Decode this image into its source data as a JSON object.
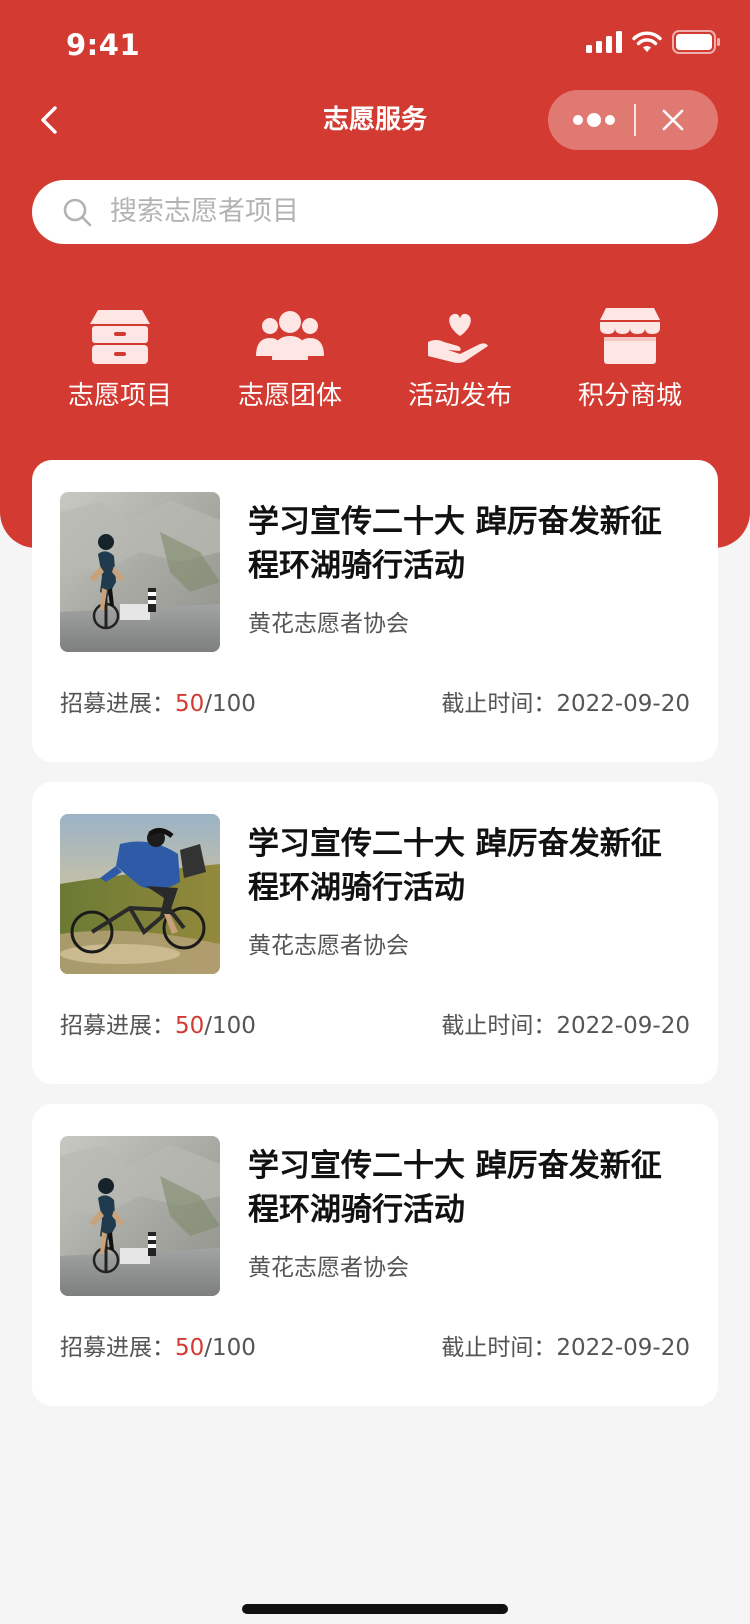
{
  "status_bar": {
    "time": "9:41",
    "icons": [
      "signal-icon",
      "wifi-icon",
      "battery-icon"
    ]
  },
  "nav": {
    "title": "志愿服务",
    "back_icon": "chevron-left-icon",
    "more_icon": "more-dots-icon",
    "close_icon": "close-icon"
  },
  "search": {
    "placeholder": "搜索志愿者项目",
    "icon": "search-icon"
  },
  "quick_links": [
    {
      "label": "志愿项目",
      "icon": "drawer-box-icon"
    },
    {
      "label": "志愿团体",
      "icon": "group-people-icon"
    },
    {
      "label": "活动发布",
      "icon": "heart-hand-icon"
    },
    {
      "label": "积分商城",
      "icon": "store-icon"
    }
  ],
  "cards": [
    {
      "title": "学习宣传二十大 踔厉奋发新征程环湖骑行活动",
      "org": "黄花志愿者协会",
      "progress_label": "招募进展：",
      "progress_current": "50",
      "progress_total": "/100",
      "deadline_label": "截止时间：",
      "deadline": "2022-09-20"
    },
    {
      "title": "学习宣传二十大 踔厉奋发新征程环湖骑行活动",
      "org": "黄花志愿者协会",
      "progress_label": "招募进展：",
      "progress_current": "50",
      "progress_total": "/100",
      "deadline_label": "截止时间：",
      "deadline": "2022-09-20"
    },
    {
      "title": "学习宣传二十大 踔厉奋发新征程环湖骑行活动",
      "org": "黄花志愿者协会",
      "progress_label": "招募进展：",
      "progress_current": "50",
      "progress_total": "/100",
      "deadline_label": "截止时间：",
      "deadline": "2022-09-20"
    }
  ],
  "colors": {
    "brand_red": "#d33a31",
    "background": "#f5f5f5",
    "card": "#ffffff"
  }
}
